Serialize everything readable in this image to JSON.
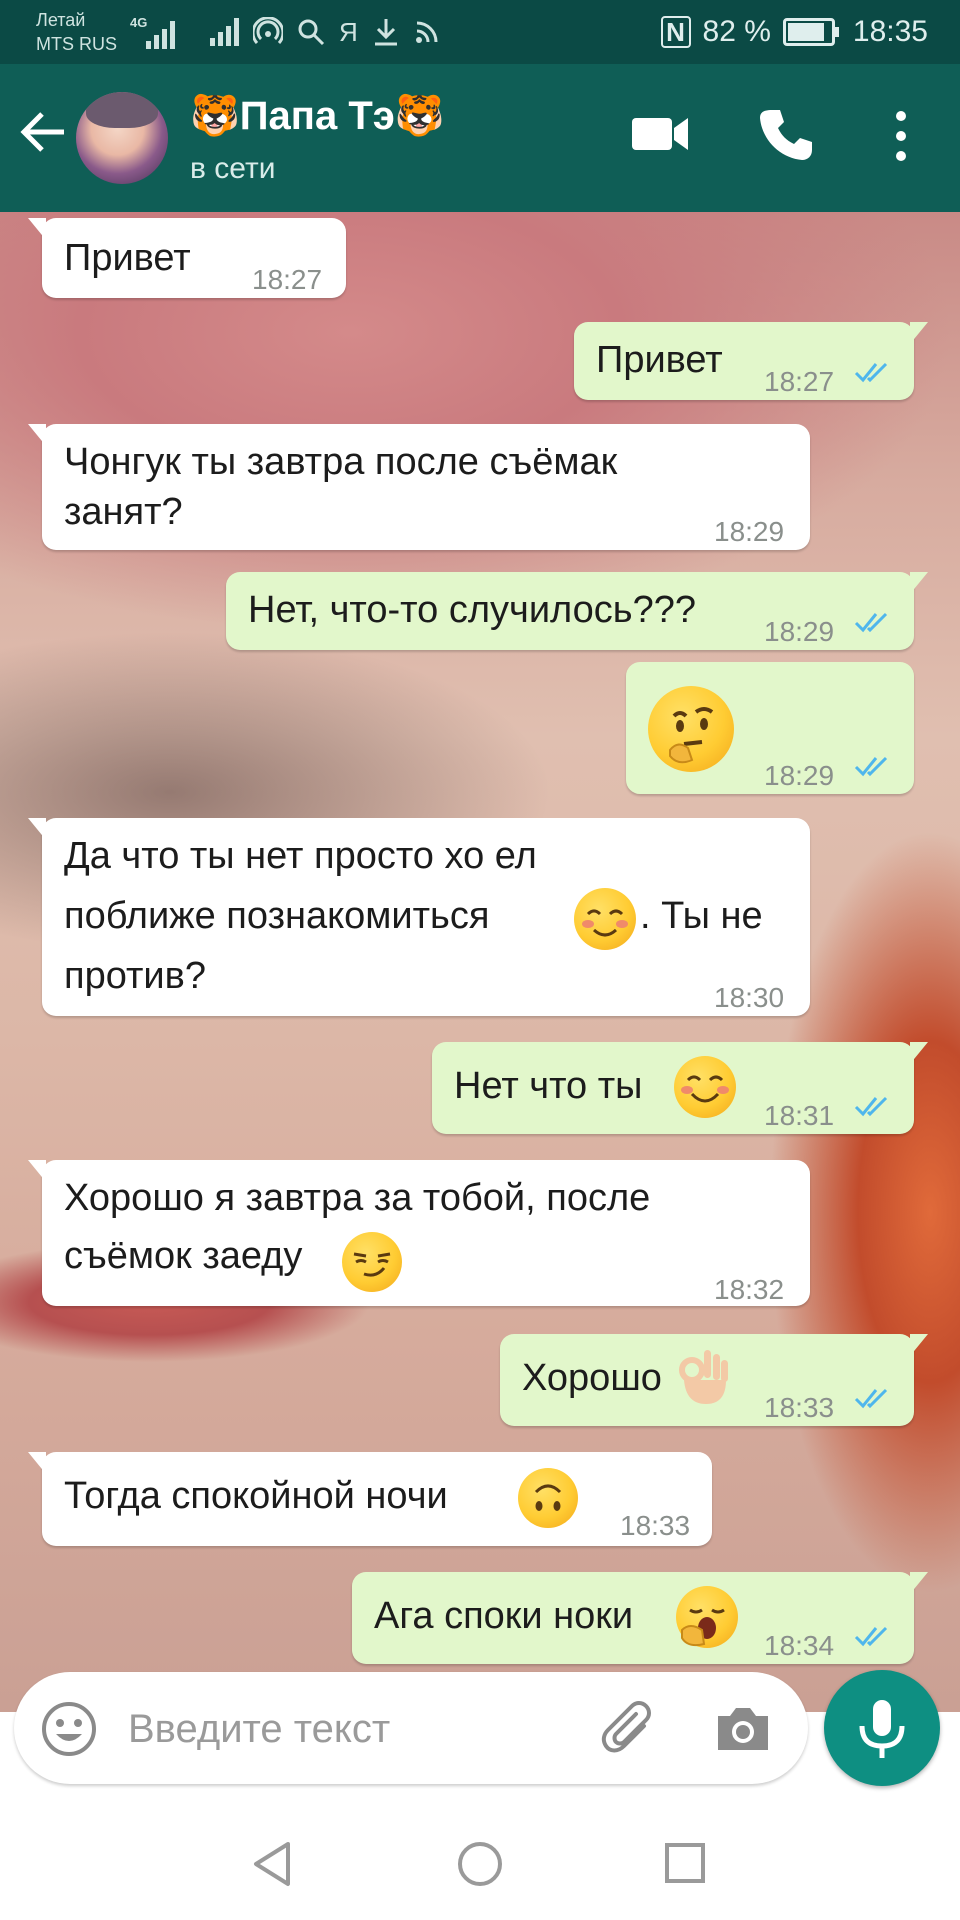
{
  "status_bar": {
    "carrier_top": "Летай",
    "carrier_bottom": "MTS RUS",
    "network": "4G",
    "yandex_icon": "Я",
    "battery": "82 %",
    "time": "18:35",
    "icons": [
      "signal-bars-icon",
      "wifi-hotspot-icon",
      "search-icon",
      "download-icon",
      "rss-icon",
      "nfc-icon",
      "battery-icon"
    ]
  },
  "header": {
    "title": "🐯Папа Тэ🐯",
    "status": "в сети",
    "colors": {
      "bar": "#0f5e56",
      "statusbar": "#0b4a45"
    }
  },
  "messages": [
    {
      "dir": "in",
      "text": "Привет",
      "time": "18:27"
    },
    {
      "dir": "out",
      "text": "Привет",
      "time": "18:27",
      "read": true
    },
    {
      "dir": "in",
      "lines": [
        "Чонгук ты завтра после съёмак",
        "занят?"
      ],
      "time": "18:29"
    },
    {
      "dir": "out",
      "text": "Нет, что-то случилось???",
      "time": "18:29",
      "read": true
    },
    {
      "dir": "out",
      "emoji": "thinking-face",
      "time": "18:29",
      "read": true
    },
    {
      "dir": "in",
      "lines": [
        "Да что ты нет просто хо ел",
        "поближе познакомиться",
        ". Ты не",
        "против?"
      ],
      "emoji": "smiling-face-blush",
      "time": "18:30"
    },
    {
      "dir": "out",
      "text": "Нет что ты",
      "emoji": "smiling-face",
      "time": "18:31",
      "read": true
    },
    {
      "dir": "in",
      "lines": [
        "Хорошо я завтра за тобой, после",
        "съёмок заеду"
      ],
      "emoji": "smirking-face",
      "time": "18:32"
    },
    {
      "dir": "out",
      "text": "Хорошо",
      "emoji": "ok-hand",
      "time": "18:33",
      "read": true
    },
    {
      "dir": "in",
      "text": "Тогда спокойной ночи",
      "emoji": "upside-down-face",
      "time": "18:33"
    },
    {
      "dir": "out",
      "text": "Ага споки ноки",
      "emoji": "yawning-face",
      "time": "18:34",
      "read": true
    }
  ],
  "input": {
    "placeholder": "Введите текст"
  },
  "colors": {
    "outgoing": "#e2f7cb",
    "incoming": "#ffffff",
    "ticks": "#4fb6ec",
    "mic": "#0e8f82"
  }
}
